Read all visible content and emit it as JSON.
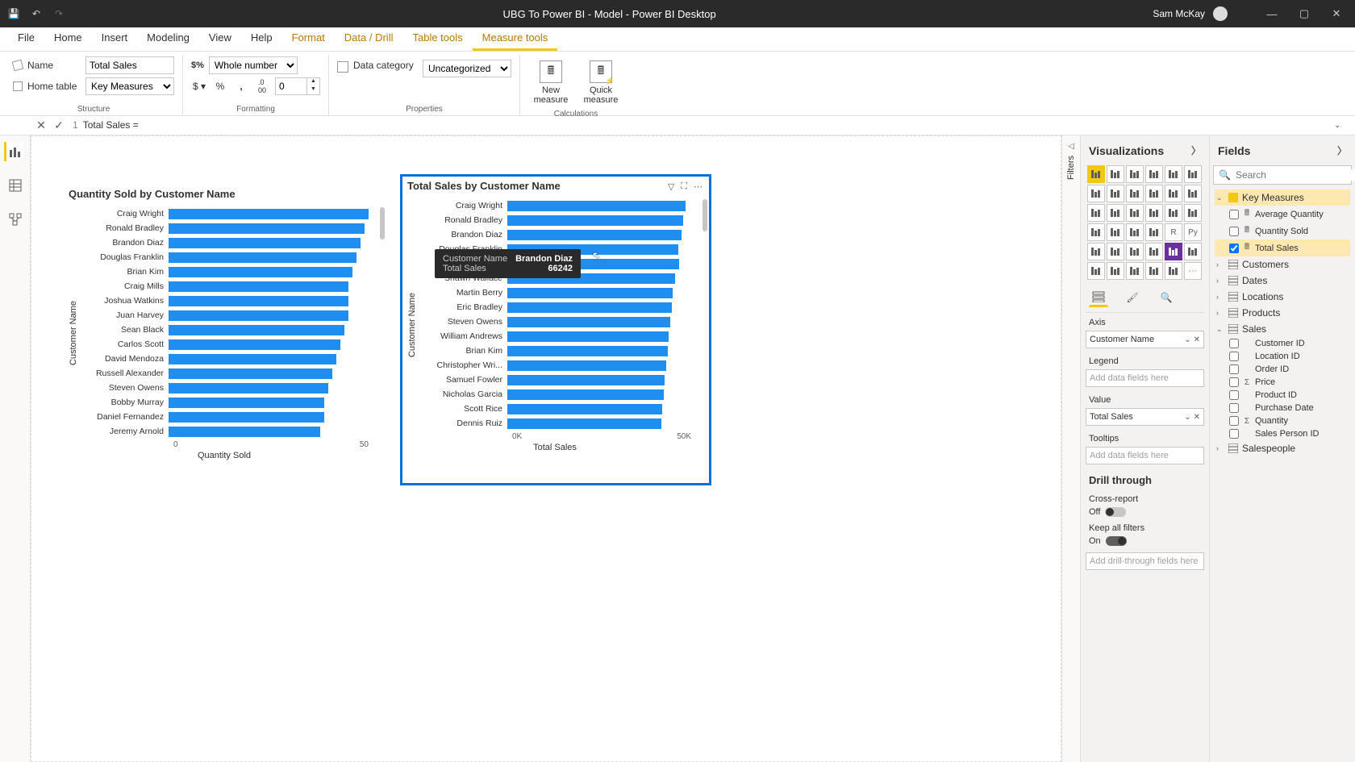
{
  "titlebar": {
    "title": "UBG To Power BI - Model - Power BI Desktop",
    "user": "Sam McKay"
  },
  "tabs": [
    "File",
    "Home",
    "Insert",
    "Modeling",
    "View",
    "Help",
    "Format",
    "Data / Drill",
    "Table tools",
    "Measure tools"
  ],
  "active_tab": "Measure tools",
  "contextual_tabs": [
    "Format",
    "Data / Drill",
    "Table tools",
    "Measure tools"
  ],
  "ribbon": {
    "structure": {
      "name_label": "Name",
      "name_value": "Total Sales",
      "home_table_label": "Home table",
      "home_table_value": "Key Measures",
      "group_label": "Structure"
    },
    "formatting": {
      "format_value": "Whole number",
      "decimals": "0",
      "group_label": "Formatting"
    },
    "properties": {
      "label": "Data category",
      "value": "Uncategorized",
      "group_label": "Properties"
    },
    "calc": {
      "new_measure": "New measure",
      "quick_measure": "Quick measure",
      "group_label": "Calculations"
    }
  },
  "formula": {
    "line": "1",
    "text": "Total Sales ="
  },
  "chart_data": [
    {
      "type": "bar",
      "orientation": "horizontal",
      "title": "Quantity Sold by Customer Name",
      "xlabel": "Quantity Sold",
      "ylabel": "Customer Name",
      "xlim": [
        0,
        50
      ],
      "xticks": [
        "0",
        "50"
      ],
      "categories": [
        "Craig Wright",
        "Ronald Bradley",
        "Brandon Diaz",
        "Douglas Franklin",
        "Brian Kim",
        "Craig Mills",
        "Joshua Watkins",
        "Juan Harvey",
        "Sean Black",
        "Carlos Scott",
        "David Mendoza",
        "Russell Alexander",
        "Steven Owens",
        "Bobby Murray",
        "Daniel Fernandez",
        "Jeremy Arnold"
      ],
      "values": [
        50,
        49,
        48,
        47,
        46,
        45,
        45,
        45,
        44,
        43,
        42,
        41,
        40,
        39,
        39,
        38
      ]
    },
    {
      "type": "bar",
      "orientation": "horizontal",
      "title": "Total Sales by Customer Name",
      "xlabel": "Total Sales",
      "ylabel": "Customer Name",
      "xlim": [
        0,
        70000
      ],
      "xticks": [
        "0K",
        "50K"
      ],
      "categories": [
        "Craig Wright",
        "Ronald Bradley",
        "Brandon Diaz",
        "Douglas Franklin",
        "Brian Kim",
        "Shawn Wallace",
        "Martin Berry",
        "Eric Bradley",
        "Steven Owens",
        "William Andrews",
        "Brian Kim",
        "Christopher Wri...",
        "Samuel Fowler",
        "Nicholas Garcia",
        "Scott Rice",
        "Dennis Ruiz"
      ],
      "values": [
        68000,
        67000,
        66242,
        65000,
        65500,
        64000,
        63000,
        62500,
        62000,
        61500,
        61000,
        60500,
        60000,
        59500,
        59000,
        58500
      ],
      "selected": true,
      "tooltip": {
        "Customer Name": "Brandon Diaz",
        "Total Sales": "66242"
      }
    }
  ],
  "viz_panel": {
    "title": "Visualizations",
    "wells": {
      "axis_label": "Axis",
      "axis_value": "Customer Name",
      "legend_label": "Legend",
      "legend_placeholder": "Add data fields here",
      "value_label": "Value",
      "value_value": "Total Sales",
      "tooltips_label": "Tooltips",
      "tooltips_placeholder": "Add data fields here"
    },
    "drill": {
      "header": "Drill through",
      "cross_label": "Cross-report",
      "cross_state": "Off",
      "keep_label": "Keep all filters",
      "keep_state": "On",
      "placeholder": "Add drill-through fields here"
    }
  },
  "filters_label": "Filters",
  "fields_panel": {
    "title": "Fields",
    "search_placeholder": "Search",
    "tables": [
      {
        "name": "Key Measures",
        "icon": "measures",
        "expanded": true,
        "selected": true,
        "fields": [
          {
            "name": "Average Quantity",
            "type": "measure",
            "checked": false
          },
          {
            "name": "Quantity Sold",
            "type": "measure",
            "checked": false
          },
          {
            "name": "Total Sales",
            "type": "measure",
            "checked": true,
            "selected": true
          }
        ]
      },
      {
        "name": "Customers",
        "icon": "table",
        "expanded": false
      },
      {
        "name": "Dates",
        "icon": "table",
        "expanded": false
      },
      {
        "name": "Locations",
        "icon": "table",
        "expanded": false
      },
      {
        "name": "Products",
        "icon": "table",
        "expanded": false
      },
      {
        "name": "Sales",
        "icon": "table",
        "expanded": true,
        "fields": [
          {
            "name": "Customer ID",
            "checked": false
          },
          {
            "name": "Location ID",
            "checked": false
          },
          {
            "name": "Order ID",
            "checked": false
          },
          {
            "name": "Price",
            "type": "sum",
            "checked": false
          },
          {
            "name": "Product ID",
            "checked": false
          },
          {
            "name": "Purchase Date",
            "checked": false
          },
          {
            "name": "Quantity",
            "type": "sum",
            "checked": false
          },
          {
            "name": "Sales Person ID",
            "checked": false
          }
        ]
      },
      {
        "name": "Salespeople",
        "icon": "table",
        "expanded": false
      }
    ]
  }
}
